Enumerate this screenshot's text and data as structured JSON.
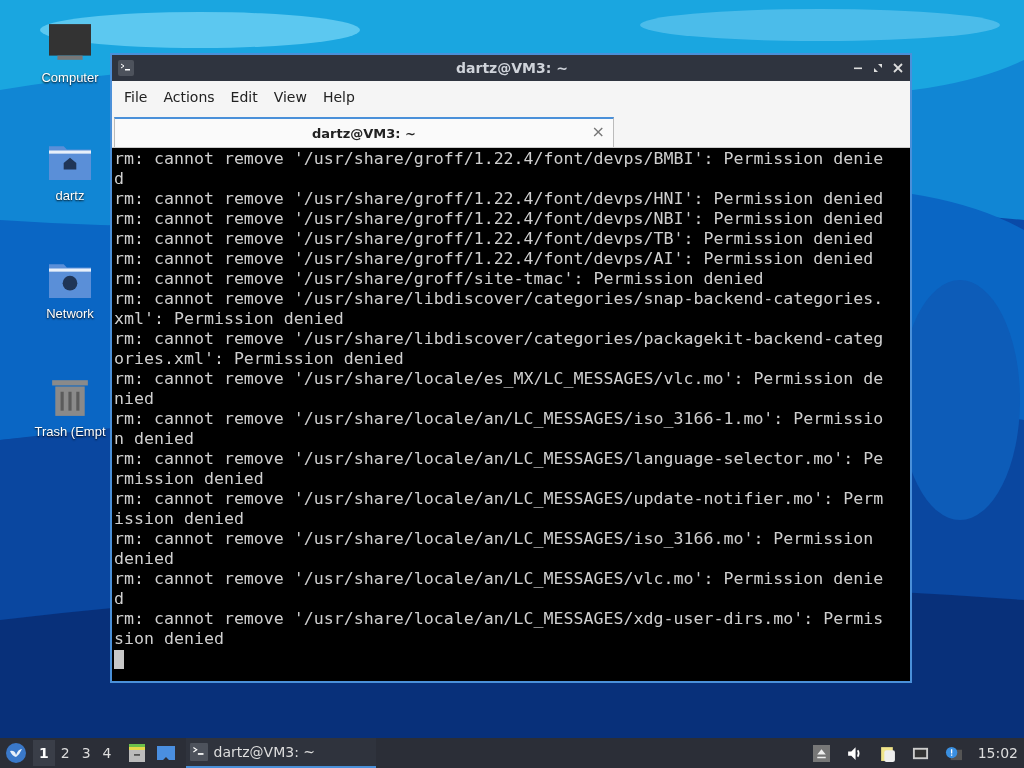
{
  "desktop_icons": [
    {
      "kind": "computer",
      "label": "Computer"
    },
    {
      "kind": "home",
      "label": "dartz"
    },
    {
      "kind": "network",
      "label": "Network"
    },
    {
      "kind": "trash",
      "label": "Trash (Empt"
    }
  ],
  "window": {
    "title": "dartz@VM3: ~",
    "menu": [
      "File",
      "Actions",
      "Edit",
      "View",
      "Help"
    ],
    "tabs": [
      {
        "label": "dartz@VM3: ~",
        "selected": true,
        "close": "×"
      }
    ],
    "terminal": {
      "lines": [
        "rm: cannot remove '/usr/share/groff/1.22.4/font/devps/BMBI': Permission denie",
        "d",
        "rm: cannot remove '/usr/share/groff/1.22.4/font/devps/HNI': Permission denied",
        "rm: cannot remove '/usr/share/groff/1.22.4/font/devps/NBI': Permission denied",
        "rm: cannot remove '/usr/share/groff/1.22.4/font/devps/TB': Permission denied",
        "rm: cannot remove '/usr/share/groff/1.22.4/font/devps/AI': Permission denied",
        "rm: cannot remove '/usr/share/groff/site-tmac': Permission denied",
        "rm: cannot remove '/usr/share/libdiscover/categories/snap-backend-categories.",
        "xml': Permission denied",
        "rm: cannot remove '/usr/share/libdiscover/categories/packagekit-backend-categ",
        "ories.xml': Permission denied",
        "rm: cannot remove '/usr/share/locale/es_MX/LC_MESSAGES/vlc.mo': Permission de",
        "nied",
        "rm: cannot remove '/usr/share/locale/an/LC_MESSAGES/iso_3166-1.mo': Permissio",
        "n denied",
        "rm: cannot remove '/usr/share/locale/an/LC_MESSAGES/language-selector.mo': Pe",
        "rmission denied",
        "rm: cannot remove '/usr/share/locale/an/LC_MESSAGES/update-notifier.mo': Perm",
        "ission denied",
        "rm: cannot remove '/usr/share/locale/an/LC_MESSAGES/iso_3166.mo': Permission",
        "denied",
        "rm: cannot remove '/usr/share/locale/an/LC_MESSAGES/vlc.mo': Permission denie",
        "d",
        "rm: cannot remove '/usr/share/locale/an/LC_MESSAGES/xdg-user-dirs.mo': Permis",
        "sion denied"
      ]
    }
  },
  "taskbar": {
    "workspaces": [
      {
        "label": "1",
        "selected": true
      },
      {
        "label": "2",
        "selected": false
      },
      {
        "label": "3",
        "selected": false
      },
      {
        "label": "4",
        "selected": false
      }
    ],
    "tasks": [
      {
        "label": "dartz@VM3: ~",
        "selected": true
      }
    ],
    "clock": "15:02"
  }
}
